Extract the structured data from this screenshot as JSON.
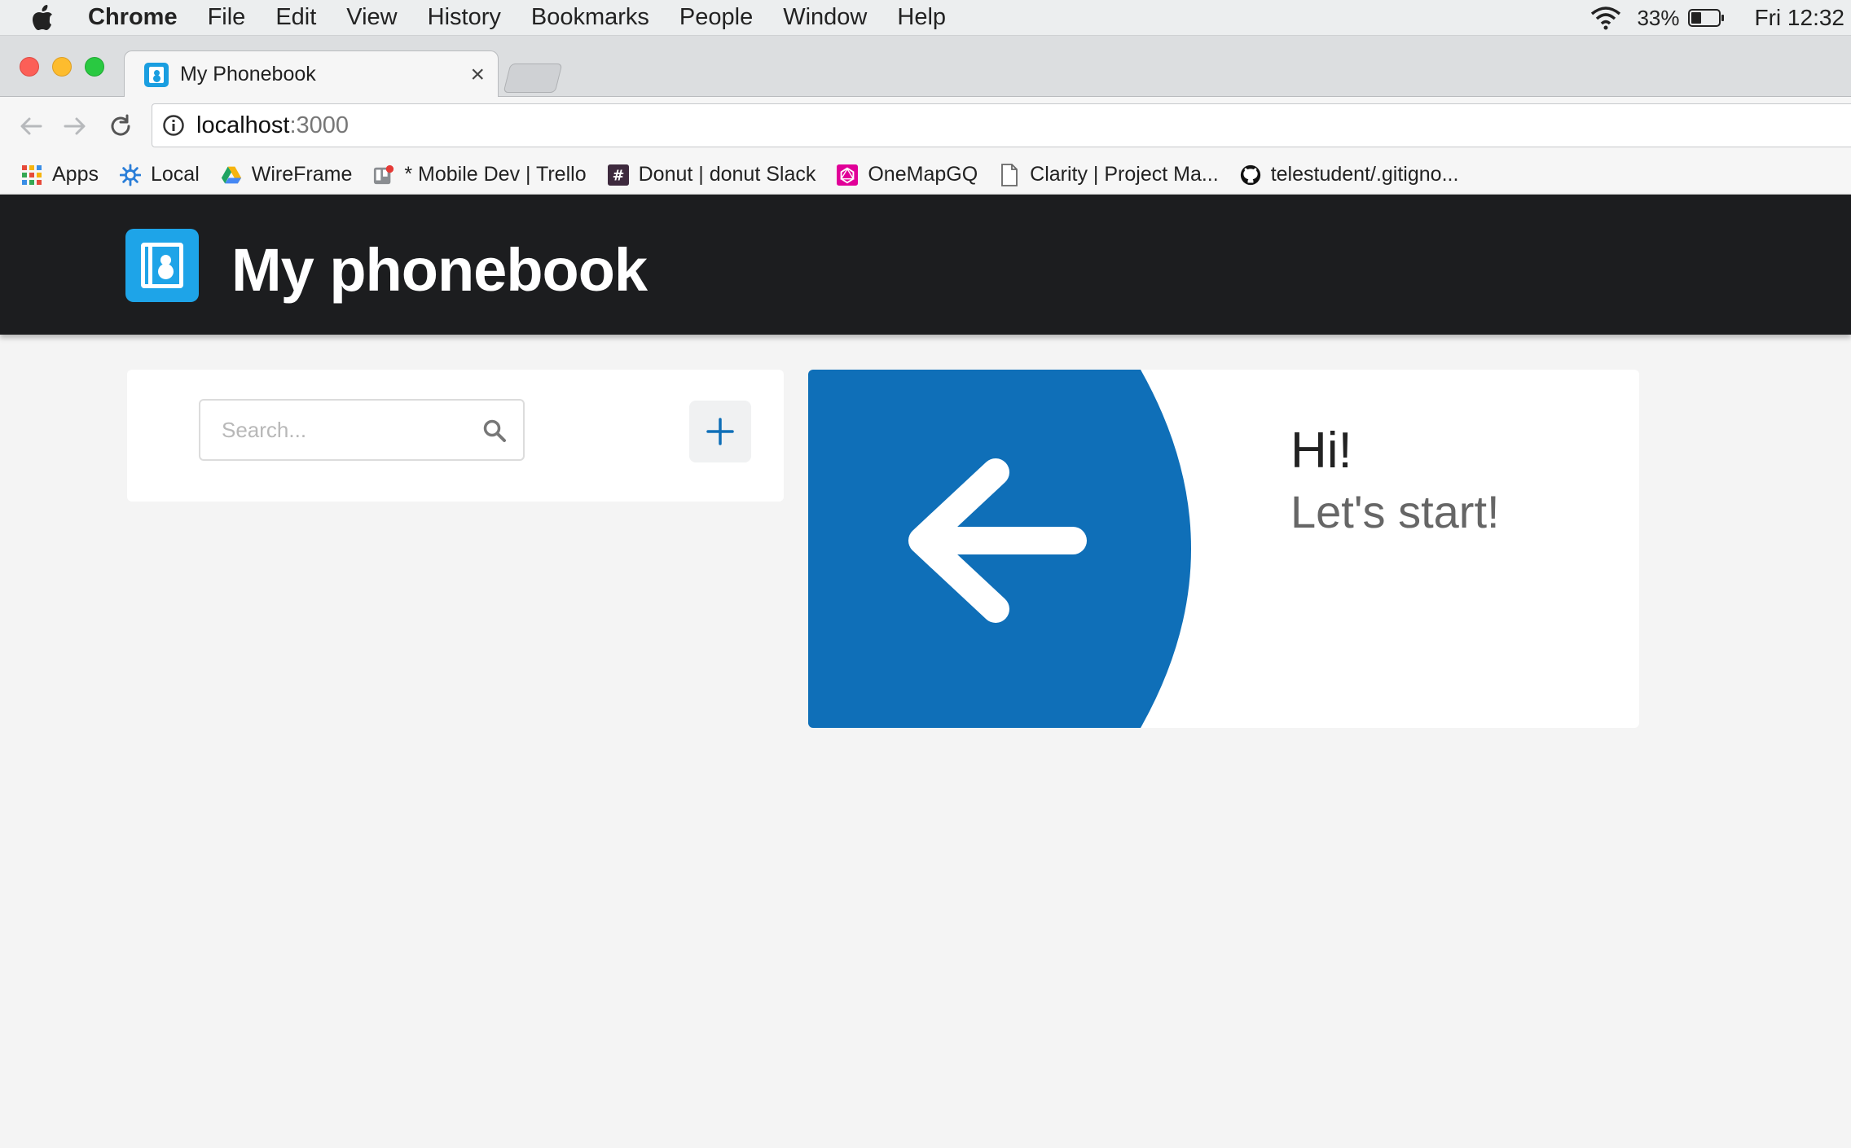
{
  "menubar": {
    "app_name": "Chrome",
    "items": [
      "File",
      "Edit",
      "View",
      "History",
      "Bookmarks",
      "People",
      "Window",
      "Help"
    ],
    "battery_percent": "33%",
    "clock": "Fri 12:32"
  },
  "tab": {
    "title": "My Phonebook",
    "close_glyph": "×"
  },
  "omnibox": {
    "host": "localhost",
    "port": ":3000"
  },
  "bookmarks": [
    {
      "label": "Apps",
      "icon": "apps-grid-icon"
    },
    {
      "label": "Local",
      "icon": "gear-icon"
    },
    {
      "label": "WireFrame",
      "icon": "google-drive-icon"
    },
    {
      "label": "* Mobile Dev | Trello",
      "icon": "trello-icon"
    },
    {
      "label": "Donut | donut Slack",
      "icon": "slack-hash-icon"
    },
    {
      "label": "OneMapGQ",
      "icon": "graphql-icon"
    },
    {
      "label": "Clarity | Project Ma...",
      "icon": "page-icon"
    },
    {
      "label": "telestudent/.gitigno...",
      "icon": "github-icon"
    }
  ],
  "header": {
    "title": "My phonebook"
  },
  "search": {
    "placeholder": "Search..."
  },
  "add_button": {
    "glyph": "+"
  },
  "welcome": {
    "greeting": "Hi!",
    "subgreeting": "Let's start!"
  },
  "colors": {
    "accent_blue": "#0f6fb8",
    "header_bg": "#1c1d1f",
    "logo_blue": "#1ea4e8",
    "page_bg": "#f4f4f4"
  }
}
